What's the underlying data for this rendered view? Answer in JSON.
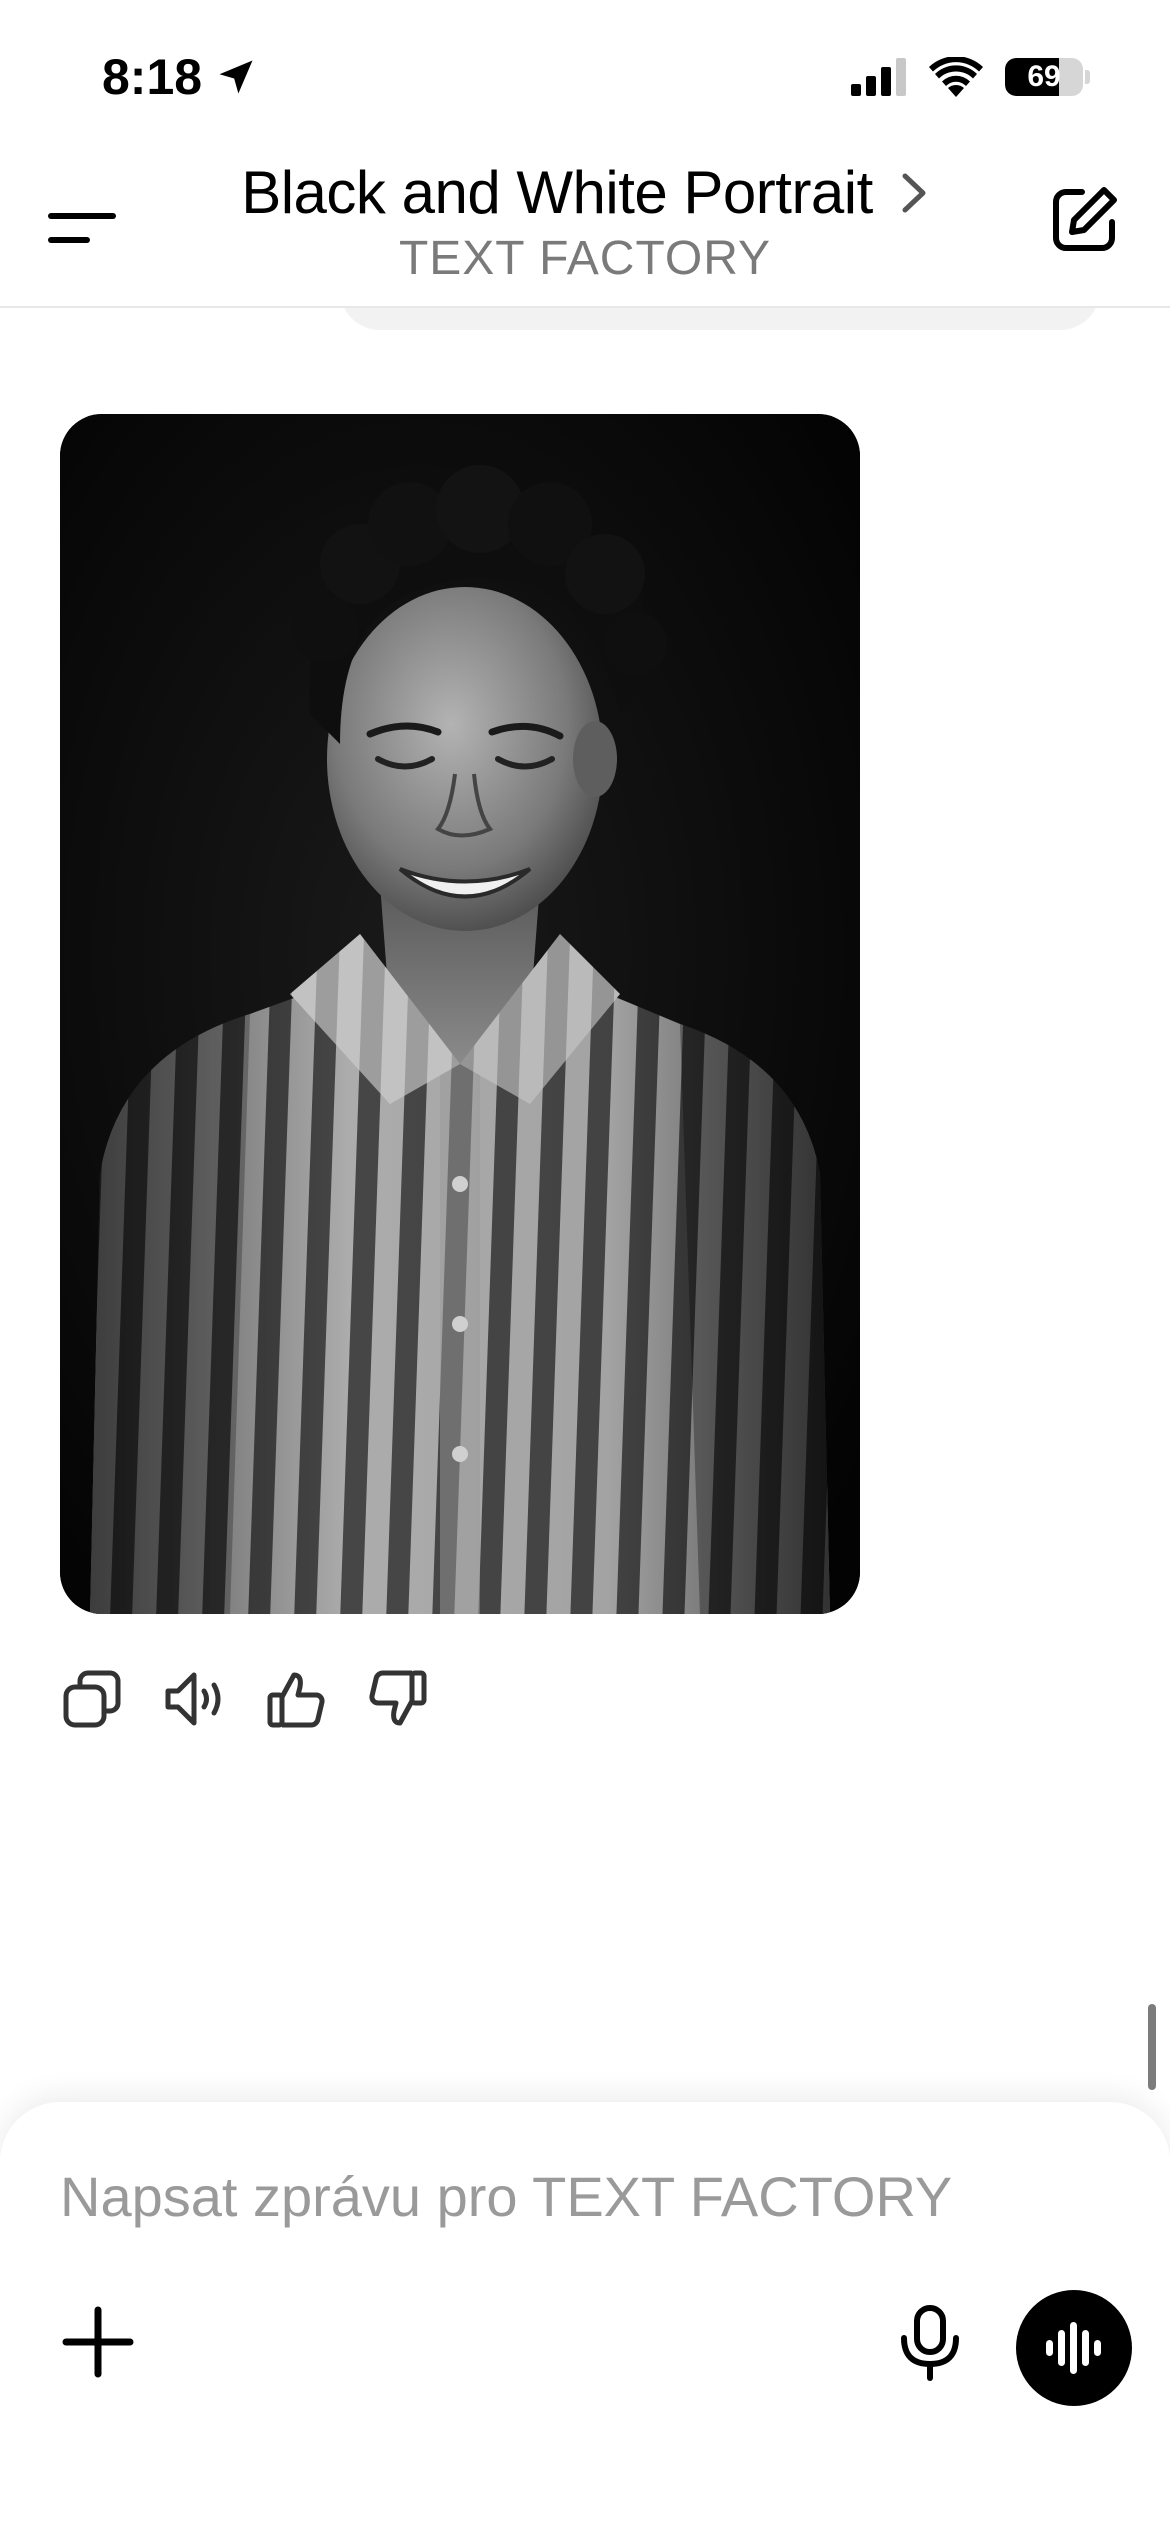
{
  "status": {
    "time": "8:18",
    "battery": "69",
    "battery_level": 0.69
  },
  "header": {
    "title": "Black and White Portrait",
    "subtitle": "TEXT FACTORY"
  },
  "message": {
    "image_description_icon": "portrait-image"
  },
  "actions": [
    "copy-icon",
    "speaker-icon",
    "thumbs-up-icon",
    "thumbs-down-icon"
  ],
  "composer": {
    "placeholder": "Napsat zprávu pro TEXT FACTORY",
    "value": ""
  },
  "colors": {
    "accent": "#000000",
    "placeholder": "#9a9a9a",
    "subtitle": "#7a7a7a"
  }
}
